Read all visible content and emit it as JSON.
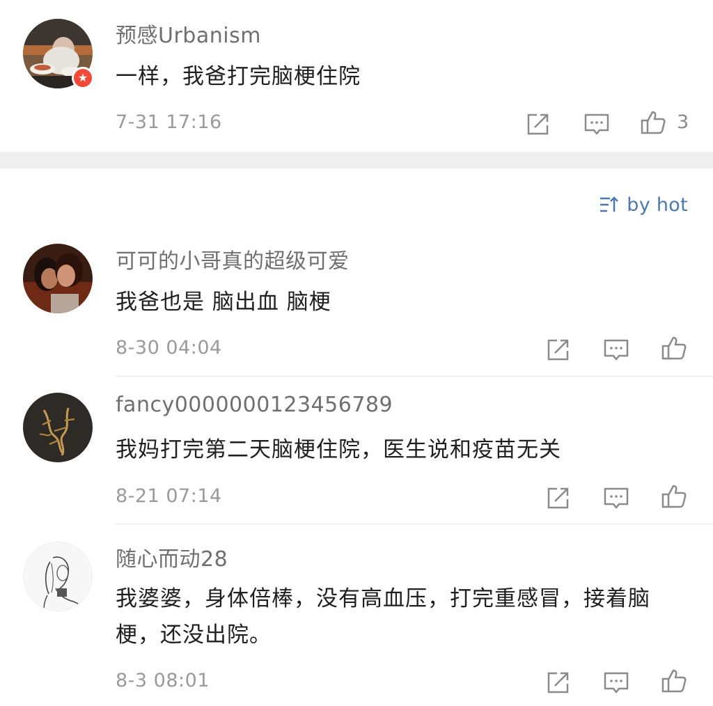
{
  "comments": [
    {
      "username": "预感Urbanism",
      "content": "一样，我爸打完脑梗住院",
      "timestamp": "7-31 17:16",
      "like_count": "3",
      "verified_badge": "★"
    },
    {
      "username": "可可的小哥真的超级可爱",
      "content": "我爸也是 脑出血 脑梗",
      "timestamp": "8-30 04:04",
      "like_count": ""
    },
    {
      "username": "fancy0000000123456789",
      "content": "我妈打完第二天脑梗住院，医生说和疫苗无关",
      "timestamp": "8-21 07:14",
      "like_count": ""
    },
    {
      "username": "随心而动28",
      "content": "我婆婆，身体倍棒，没有高血压，打完重感冒，接着脑梗，还没出院。",
      "timestamp": "8-3 08:01",
      "like_count": ""
    }
  ],
  "sort": {
    "label": "by hot",
    "icon": "sort-icon"
  },
  "icons": {
    "repost": "share-icon",
    "reply": "comment-icon",
    "like": "thumbs-up-icon"
  },
  "colors": {
    "username": "#6f6f6f",
    "content": "#1f1f1f",
    "timestamp": "#9a9a9a",
    "icon": "#8a8a8a",
    "link": "#4a79b0",
    "badge": "#ef4b36",
    "section_gap": "#efefef"
  }
}
